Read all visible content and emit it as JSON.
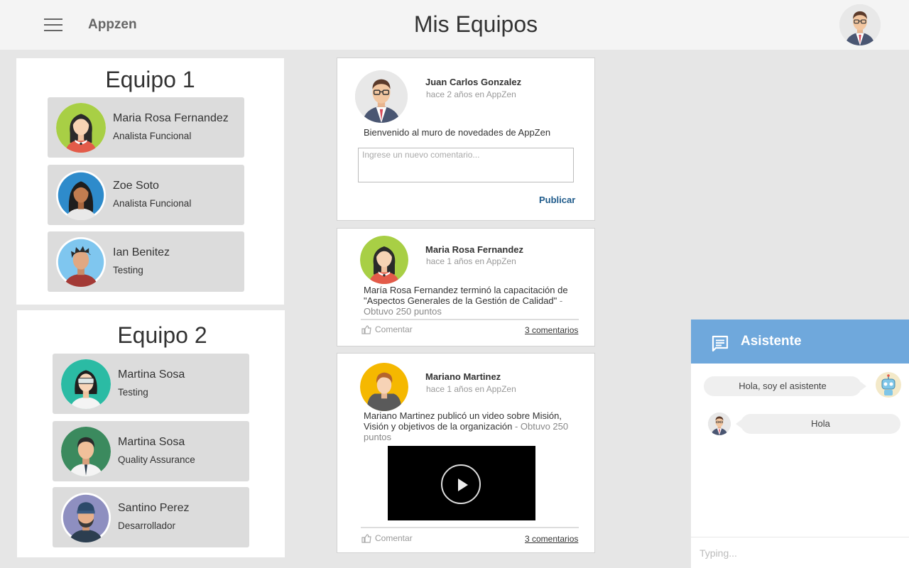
{
  "header": {
    "brand": "Appzen",
    "title": "Mis Equipos"
  },
  "teams": [
    {
      "title": "Equipo 1",
      "members": [
        {
          "name": "Maria Rosa Fernandez",
          "role": "Analista Funcional",
          "avatar_bg": "#a8cf45"
        },
        {
          "name": "Zoe Soto",
          "role": "Analista Funcional",
          "avatar_bg": "#2e8bcb"
        },
        {
          "name": "Ian Benitez",
          "role": "Testing",
          "avatar_bg": "#7fc6ef"
        }
      ]
    },
    {
      "title": "Equipo 2",
      "members": [
        {
          "name": "Martina Sosa",
          "role": "Testing",
          "avatar_bg": "#2bbba4"
        },
        {
          "name": "Martina Sosa",
          "role": "Quality Assurance",
          "avatar_bg": "#3b8a5e"
        },
        {
          "name": "Santino Perez",
          "role": "Desarrollador",
          "avatar_bg": "#8e8fc0"
        }
      ]
    }
  ],
  "feed": {
    "composer": {
      "author": "Juan Carlos Gonzalez",
      "time": "hace 2 años en AppZen",
      "welcome": "Bienvenido al muro de novedades de AppZen",
      "placeholder": "Ingrese un nuevo comentario...",
      "publish": "Publicar"
    },
    "posts": [
      {
        "author": "Maria Rosa Fernandez",
        "time": "hace 1 años en AppZen",
        "text": "María Rosa Fernandez terminó la capacitación de \"Aspectos Generales de la Gestión de Calidad\"",
        "points": " - Obtuvo  250 puntos",
        "comment_label": "Comentar",
        "comments": "3 comentarios"
      },
      {
        "author": "Mariano Martinez",
        "time": "hace 1 años en AppZen",
        "text": "Mariano Martinez publicó un video sobre Misión, Visión y objetivos de la organización",
        "points": " - Obtuvo 250 puntos",
        "comment_label": "Comentar",
        "comments": "3 comentarios"
      }
    ]
  },
  "assistant": {
    "title": "Asistente",
    "messages": [
      {
        "from": "bot",
        "text": "Hola, soy el asistente"
      },
      {
        "from": "user",
        "text": "Hola"
      }
    ],
    "input_placeholder": "Typing..."
  },
  "colors": {
    "assistant_header": "#6fa8dc",
    "publish_link": "#1e5a8a",
    "card_bg": "#dcdcdc"
  }
}
